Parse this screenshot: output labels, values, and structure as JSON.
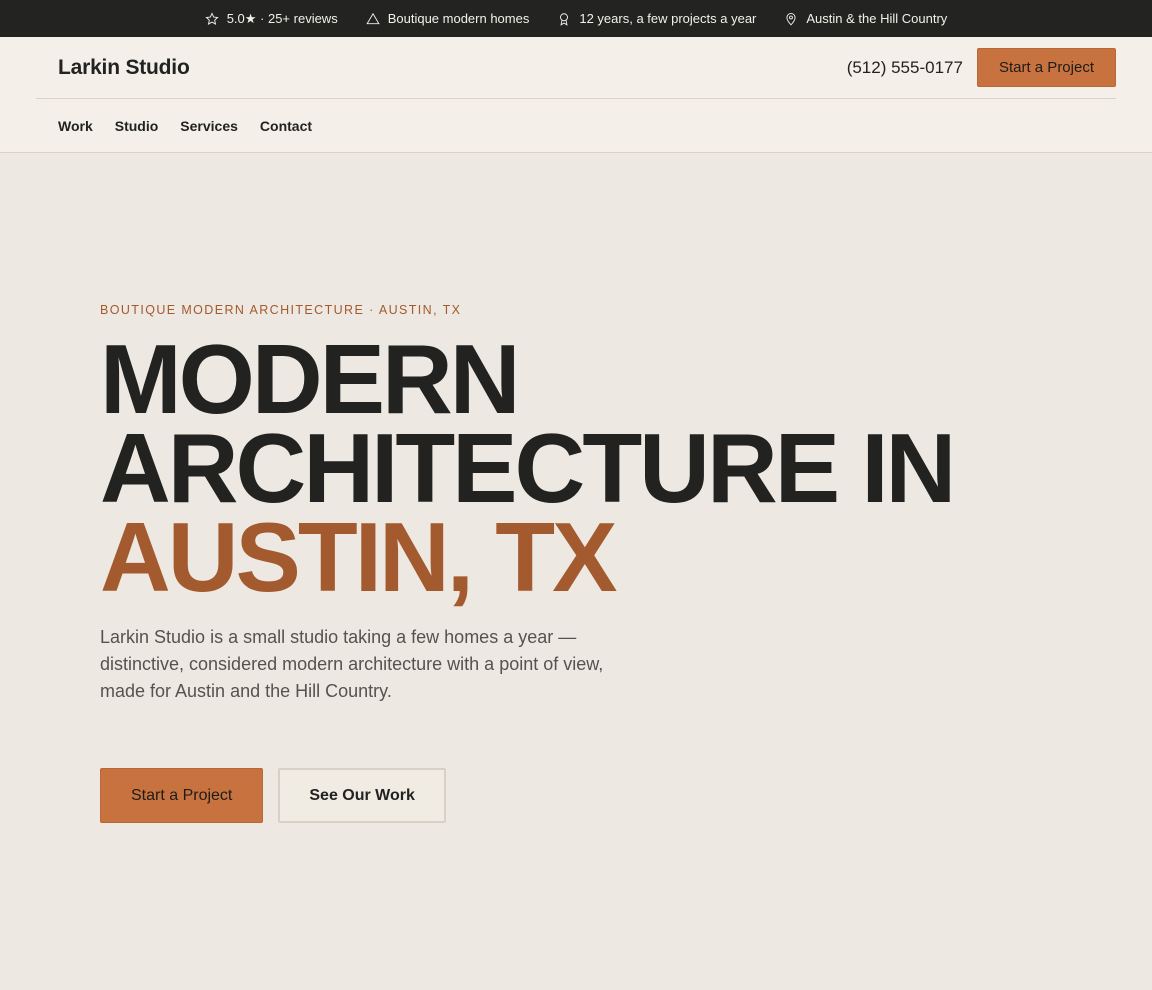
{
  "topbar": {
    "items": [
      {
        "icon": "star-icon",
        "text": "5.0★ · 25+ reviews"
      },
      {
        "icon": "triangle-icon",
        "text": "Boutique modern homes"
      },
      {
        "icon": "award-icon",
        "text": "12 years, a few projects a year"
      },
      {
        "icon": "map-pin-icon",
        "text": "Austin & the Hill Country"
      }
    ]
  },
  "header": {
    "brand": "Larkin Studio",
    "phone": "(512) 555-0177",
    "cta_label": "Start a Project"
  },
  "nav": {
    "items": [
      {
        "label": "Work"
      },
      {
        "label": "Studio"
      },
      {
        "label": "Services"
      },
      {
        "label": "Contact"
      }
    ]
  },
  "hero": {
    "eyebrow": "BOUTIQUE MODERN ARCHITECTURE · AUSTIN, TX",
    "headline_line1": "MODERN",
    "headline_line2": "ARCHITECTURE IN",
    "headline_accent": "AUSTIN, TX",
    "lede": "Larkin Studio is a small studio taking a few homes a year — distinctive, considered modern architecture with a point of view, made for Austin and the Hill Country.",
    "primary_cta": "Start a Project",
    "secondary_cta": "See Our Work"
  },
  "colors": {
    "accent": "#c8733f",
    "accent_text": "#a35a2e",
    "topbar_bg": "#232321",
    "page_bg": "#ede8e1"
  }
}
